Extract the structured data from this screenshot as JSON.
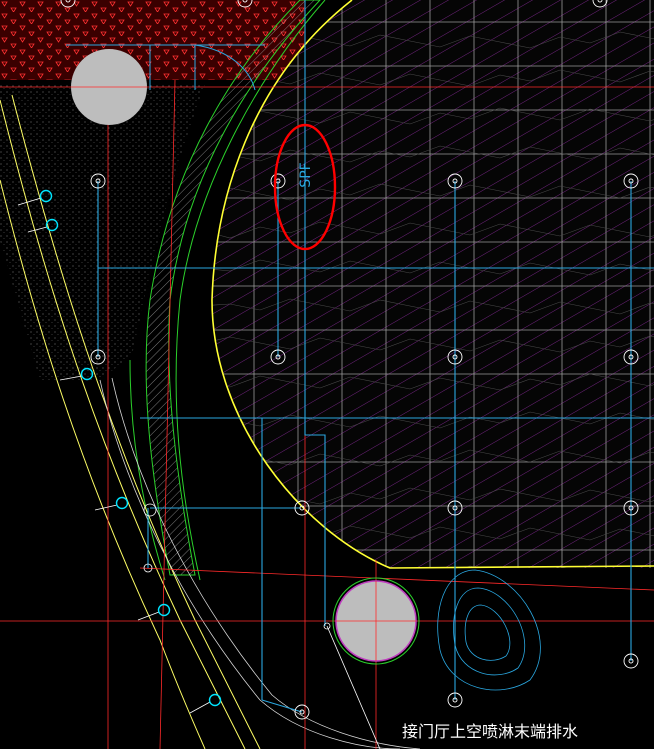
{
  "drawing": {
    "pipe_tag": "SPF",
    "note": "接门厅上空喷淋末端排水"
  },
  "colors": {
    "background": "#000000",
    "pipe": "#2aa7e0",
    "axis": "#ff2a2a",
    "boundary": "#ffff33",
    "wall": "#ffff66",
    "green_edge": "#2bd12b",
    "grid": "#b4b4b4",
    "hatch": "#8a2a9c",
    "column": "#b8b8b8",
    "marker": "#ff0000",
    "text": "#ffffff",
    "sprinkler": "#ffffff",
    "drain": "#00e5ff"
  },
  "icons": {
    "sprinkler": "sprinkler-head-icon",
    "drain": "floor-drain-icon",
    "column": "round-column-icon",
    "highlight": "revision-cloud-icon"
  }
}
